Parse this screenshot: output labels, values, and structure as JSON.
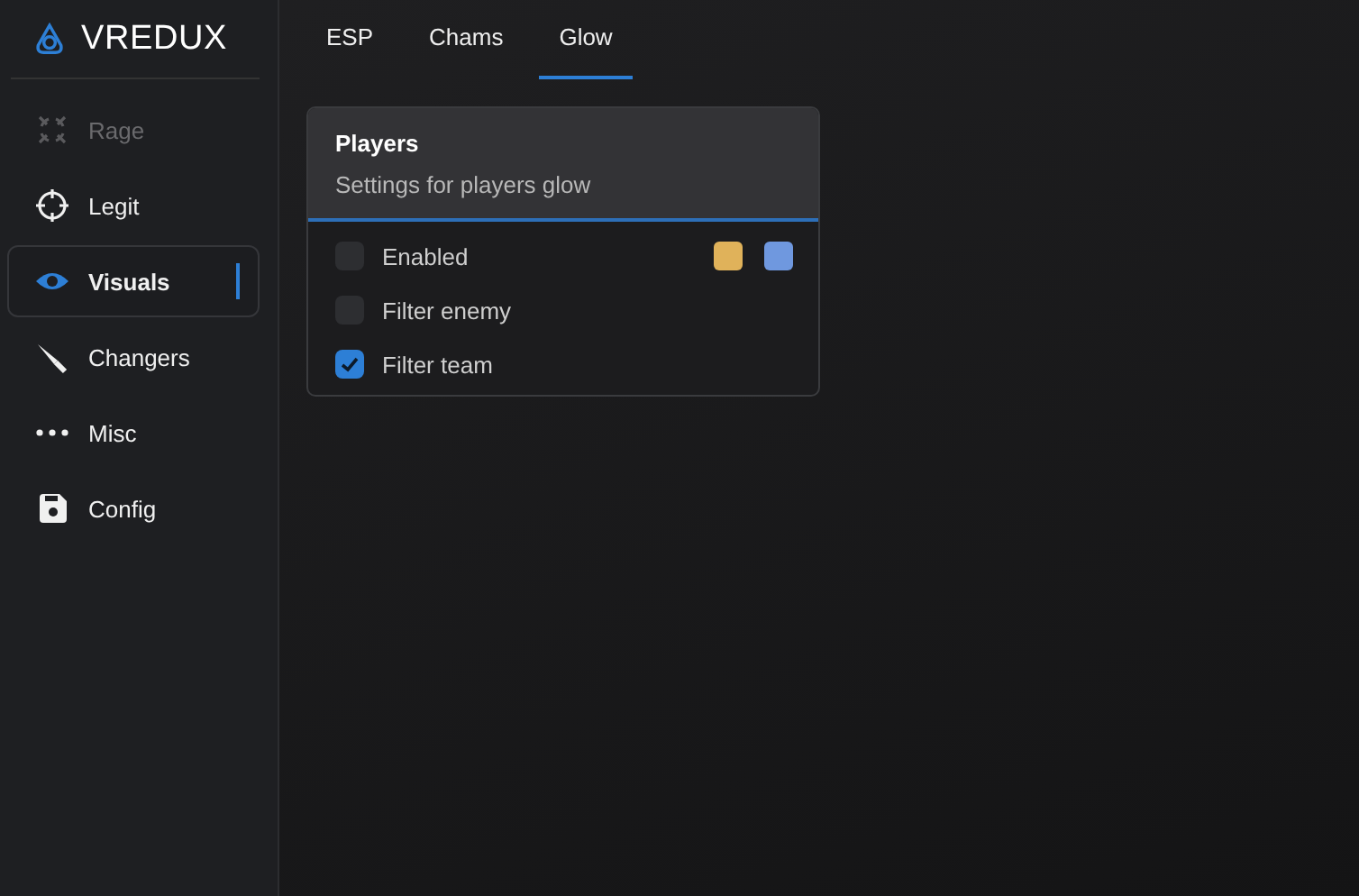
{
  "logo": {
    "text": "VREDUX"
  },
  "sidebar": {
    "items": [
      {
        "label": "Rage",
        "selected": false,
        "disabled": true
      },
      {
        "label": "Legit",
        "selected": false,
        "disabled": false
      },
      {
        "label": "Visuals",
        "selected": true,
        "disabled": false
      },
      {
        "label": "Changers",
        "selected": false,
        "disabled": false
      },
      {
        "label": "Misc",
        "selected": false,
        "disabled": false
      },
      {
        "label": "Config",
        "selected": false,
        "disabled": false
      }
    ]
  },
  "tabs": [
    {
      "label": "ESP",
      "selected": false
    },
    {
      "label": "Chams",
      "selected": false
    },
    {
      "label": "Glow",
      "selected": true
    }
  ],
  "card": {
    "title": "Players",
    "subtitle": "Settings for players glow",
    "options": [
      {
        "label": "Enabled",
        "checked": false,
        "swatches": [
          {
            "color": "#e0b25a"
          },
          {
            "color": "#6f98df"
          }
        ]
      },
      {
        "label": "Filter enemy",
        "checked": false
      },
      {
        "label": "Filter team",
        "checked": true
      }
    ]
  }
}
